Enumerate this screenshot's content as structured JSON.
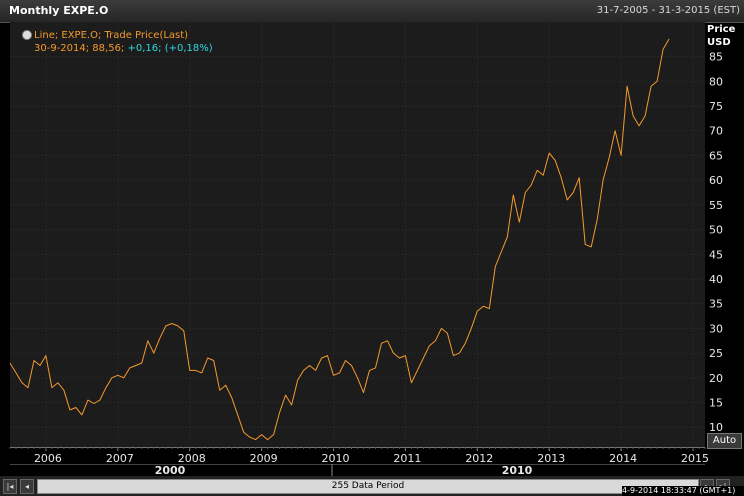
{
  "window": {
    "title": "Monthly EXPE.O",
    "date_range": "31-7-2005 - 31-3-2015 (EST)"
  },
  "legend": {
    "line1": "Line; EXPE.O; Trade Price(Last)",
    "date_value": "30-9-2014; 88,56;",
    "change": "+0,16; (+0,18%)"
  },
  "y_axis": {
    "label_price": "Price",
    "label_unit": "USD",
    "ticks": [
      "85",
      "80",
      "75",
      "70",
      "65",
      "60",
      "55",
      "50",
      "45",
      "40",
      "35",
      "30",
      "25",
      "20",
      "15",
      "10"
    ]
  },
  "x_axis": {
    "year_ticks": [
      "2006",
      "2007",
      "2008",
      "2009",
      "2010",
      "2011",
      "2012",
      "2013",
      "2014",
      "2015"
    ],
    "decade_ticks": [
      "2000",
      "2010"
    ]
  },
  "controls": {
    "auto_label": "Auto",
    "scroll_label": "255 Data Period",
    "btn_first": "|◂",
    "btn_prev": "◂",
    "btn_next": "▸",
    "btn_last": "▸|"
  },
  "status": {
    "timestamp": "4-9-2014 18:33:47 (GMT+1)"
  },
  "colors": {
    "line": "#f39a2c",
    "change": "#2fd7e0",
    "background": "#1c1c1c"
  },
  "chart_data": {
    "type": "line",
    "title": "Monthly EXPE.O",
    "ylabel": "Price USD",
    "xlabel": "",
    "ylim": [
      6,
      92
    ],
    "xlim": [
      "2005-07",
      "2015-03"
    ],
    "legend_position": "top-left",
    "grid": true,
    "series": [
      {
        "name": "Line; EXPE.O; Trade Price(Last)",
        "x": [
          "2005-07",
          "2005-08",
          "2005-09",
          "2005-10",
          "2005-11",
          "2005-12",
          "2006-01",
          "2006-02",
          "2006-03",
          "2006-04",
          "2006-05",
          "2006-06",
          "2006-07",
          "2006-08",
          "2006-09",
          "2006-10",
          "2006-11",
          "2006-12",
          "2007-01",
          "2007-02",
          "2007-03",
          "2007-04",
          "2007-05",
          "2007-06",
          "2007-07",
          "2007-08",
          "2007-09",
          "2007-10",
          "2007-11",
          "2007-12",
          "2008-01",
          "2008-02",
          "2008-03",
          "2008-04",
          "2008-05",
          "2008-06",
          "2008-07",
          "2008-08",
          "2008-09",
          "2008-10",
          "2008-11",
          "2008-12",
          "2009-01",
          "2009-02",
          "2009-03",
          "2009-04",
          "2009-05",
          "2009-06",
          "2009-07",
          "2009-08",
          "2009-09",
          "2009-10",
          "2009-11",
          "2009-12",
          "2010-01",
          "2010-02",
          "2010-03",
          "2010-04",
          "2010-05",
          "2010-06",
          "2010-07",
          "2010-08",
          "2010-09",
          "2010-10",
          "2010-11",
          "2010-12",
          "2011-01",
          "2011-02",
          "2011-03",
          "2011-04",
          "2011-05",
          "2011-06",
          "2011-07",
          "2011-08",
          "2011-09",
          "2011-10",
          "2011-11",
          "2011-12",
          "2012-01",
          "2012-02",
          "2012-03",
          "2012-04",
          "2012-05",
          "2012-06",
          "2012-07",
          "2012-08",
          "2012-09",
          "2012-10",
          "2012-11",
          "2012-12",
          "2013-01",
          "2013-02",
          "2013-03",
          "2013-04",
          "2013-05",
          "2013-06",
          "2013-07",
          "2013-08",
          "2013-09",
          "2013-10",
          "2013-11",
          "2013-12",
          "2014-01",
          "2014-02",
          "2014-03",
          "2014-04",
          "2014-05",
          "2014-06",
          "2014-07",
          "2014-08",
          "2014-09"
        ],
        "values": [
          23,
          21,
          19,
          18,
          23.5,
          22.5,
          24.5,
          18,
          19,
          17.5,
          13.5,
          14,
          12.5,
          15.5,
          14.8,
          15.5,
          18,
          20,
          20.5,
          20,
          22,
          22.5,
          23,
          27.5,
          25,
          28,
          30.5,
          31,
          30.5,
          29.5,
          21.5,
          21.5,
          21,
          24,
          23.5,
          17.5,
          18.5,
          16,
          12.5,
          9,
          8,
          7.5,
          8.5,
          7.5,
          8.5,
          13,
          16.5,
          14.5,
          19.5,
          21.5,
          22.5,
          21.5,
          24,
          24.5,
          20.5,
          21,
          23.5,
          22.5,
          20,
          17,
          21.5,
          22,
          27,
          27.5,
          25,
          24,
          24.5,
          19,
          21.5,
          24,
          26.5,
          27.5,
          30,
          29,
          24.5,
          25,
          27,
          30,
          33.5,
          34.5,
          34,
          42.5,
          45.5,
          48.5,
          57,
          51.5,
          57.5,
          59,
          62,
          61,
          65.5,
          64,
          60.5,
          56,
          57.5,
          60.5,
          47,
          46.5,
          52,
          60,
          64.5,
          70,
          65,
          79,
          73,
          71,
          73,
          79,
          80,
          86.5,
          88.56
        ]
      }
    ]
  }
}
